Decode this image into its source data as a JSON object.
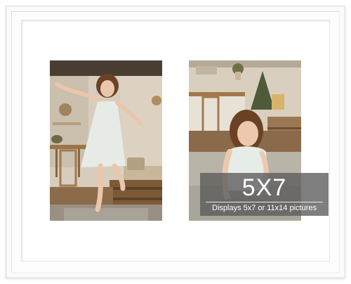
{
  "product": {
    "badge": {
      "size": "5X7",
      "caption": "Displays 5x7 or 11x14 pictures"
    }
  },
  "colors": {
    "frame": "#ffffff",
    "mat": "#ffffff",
    "badge_background": "#5a5a5a",
    "badge_text": "#ffffff"
  }
}
